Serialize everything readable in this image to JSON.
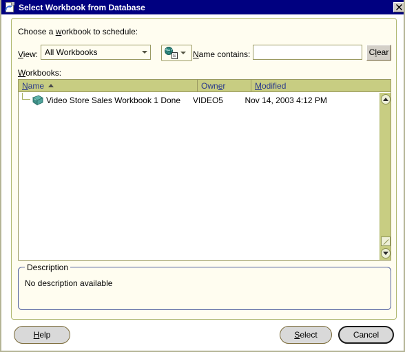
{
  "window": {
    "title": "Select Workbook from Database",
    "icon": "workbook-document-icon",
    "close_label": "✕"
  },
  "form": {
    "choose_label": "Choose a workbook to schedule:",
    "choose_label_accel": "w",
    "view_label": "View:",
    "view_label_accel": "V",
    "view_value": "All Workbooks",
    "view_options": [
      "All Workbooks"
    ],
    "globe_button_icon": "globe-database-icon",
    "globe_button_badge": "E",
    "name_contains_label": "Name contains:",
    "name_contains_accel": "N",
    "name_contains_value": "",
    "name_contains_placeholder": "",
    "clear_label": "Clear",
    "clear_accel": "l",
    "workbooks_label": "Workbooks:",
    "workbooks_label_accel": "W"
  },
  "list": {
    "columns": [
      {
        "label": "Name",
        "accel": "a",
        "sorted": "ascending"
      },
      {
        "label": "Owner",
        "accel": "e",
        "sorted": ""
      },
      {
        "label": "Modified",
        "accel": "M",
        "sorted": ""
      }
    ],
    "rows": [
      {
        "icon": "workbook-icon",
        "name": "Video Store Sales Workbook 1 Done",
        "owner": "VIDEO5",
        "modified": "Nov 14, 2003 4:12 PM"
      }
    ]
  },
  "description": {
    "legend": "Description",
    "text": "No description available"
  },
  "buttons": {
    "help": "Help",
    "help_accel": "H",
    "select": "Select",
    "select_accel": "S",
    "cancel": "Cancel"
  },
  "colors": {
    "titlebar": "#000080",
    "panel": "#fffdf0",
    "panel_border": "#b0b870",
    "header_row": "#c8cd82",
    "header_link": "#2a3a8c",
    "description_border": "#4f5f9e",
    "button_face": "#d9d9d9"
  }
}
